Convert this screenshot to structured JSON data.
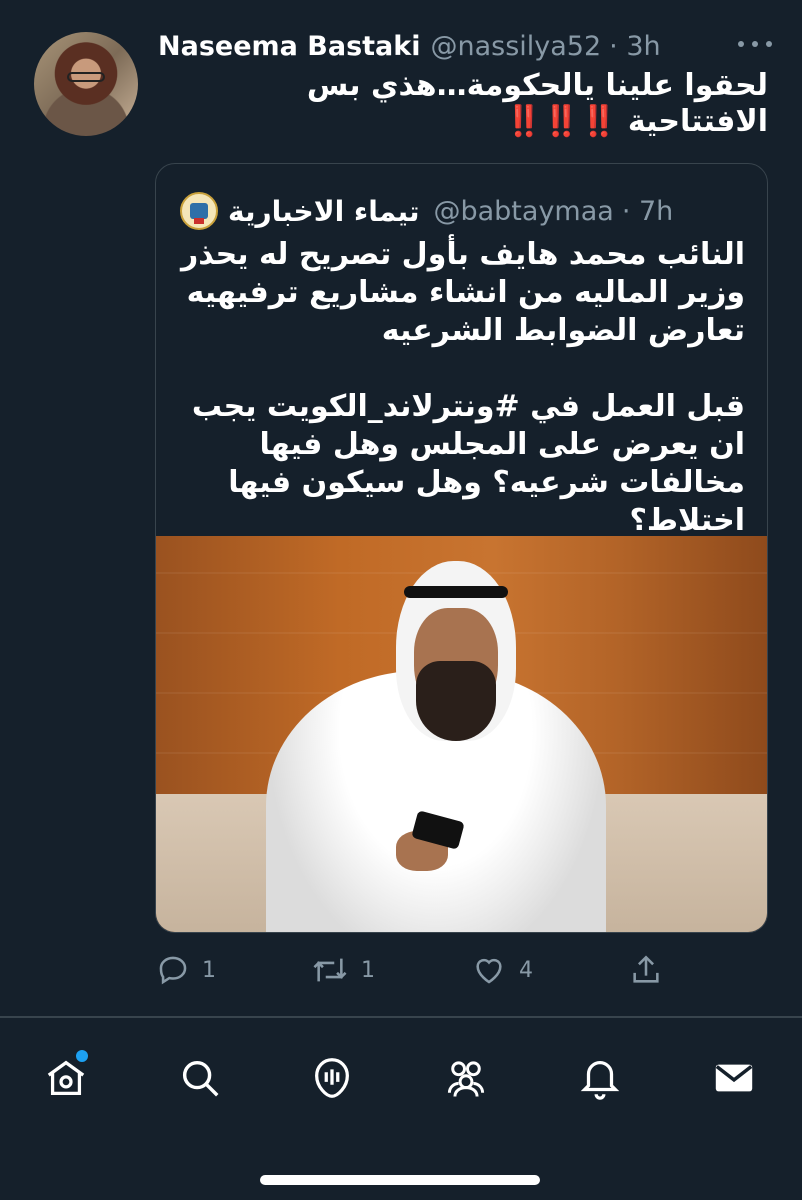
{
  "tweet": {
    "author_name": "Naseema Bastaki",
    "author_handle": "@nassilya52",
    "time": "· 3h",
    "text_line1": "لحقوا علينا يالحكومة…هذي بس",
    "text_line2_prefix": "الافتتاحية",
    "text_line2_marks": "‼️‼️‼️"
  },
  "quoted": {
    "name": "تيماء الاخبارية",
    "handle": "@babtaymaa",
    "time": "· 7h",
    "paragraph1": "النائب محمد هايف بأول تصريح له يحذر وزير الماليه من انشاء مشاريع ترفيهيه تعارض الضوابط الشرعيه",
    "paragraph2": "قبل العمل في #ونترلاند_الكويت يجب ان يعرض على المجلس وهل فيها مخالفات شرعيه؟ وهل سيكون فيها اختلاط؟"
  },
  "actions": {
    "replies": "1",
    "retweets": "1",
    "likes": "4"
  },
  "icons": {
    "more": "more-icon",
    "reply": "reply-icon",
    "retweet": "retweet-icon",
    "like": "heart-icon",
    "share": "share-icon",
    "home": "home-icon",
    "search": "search-icon",
    "spaces": "spaces-icon",
    "communities": "communities-icon",
    "notifications": "bell-icon",
    "messages": "mail-icon"
  },
  "colors": {
    "background": "#15202b",
    "secondary_text": "#8899a6",
    "accent": "#1da1f2",
    "exclamation": "#e0245e"
  }
}
